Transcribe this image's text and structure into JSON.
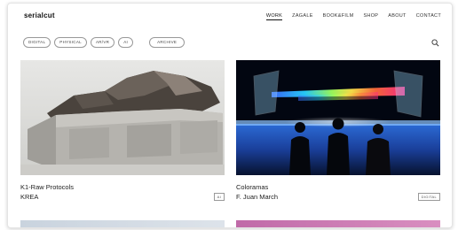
{
  "site": {
    "logo": "serialcut"
  },
  "nav": {
    "items": [
      {
        "label": "WORK",
        "active": true
      },
      {
        "label": "ZAGALE",
        "active": false
      },
      {
        "label": "BOOK&FILM",
        "active": false
      },
      {
        "label": "SHOP",
        "active": false
      },
      {
        "label": "ABOUT",
        "active": false
      },
      {
        "label": "CONTACT",
        "active": false
      }
    ]
  },
  "filters": {
    "items": [
      "DIGITAL",
      "PHYSICAL",
      "AR/VR",
      "AI"
    ],
    "archive": "ARCHIVE"
  },
  "search": {
    "icon": "search-icon"
  },
  "projects": [
    {
      "title": "K1-Raw Protocols",
      "author": "KREA",
      "tag": "AI"
    },
    {
      "title": "Coloramas",
      "author": "F. Juan March",
      "tag": "DIGITAL"
    }
  ],
  "colors": {
    "accent": "#111111",
    "background": "#ffffff",
    "chip_border": "#999999"
  }
}
